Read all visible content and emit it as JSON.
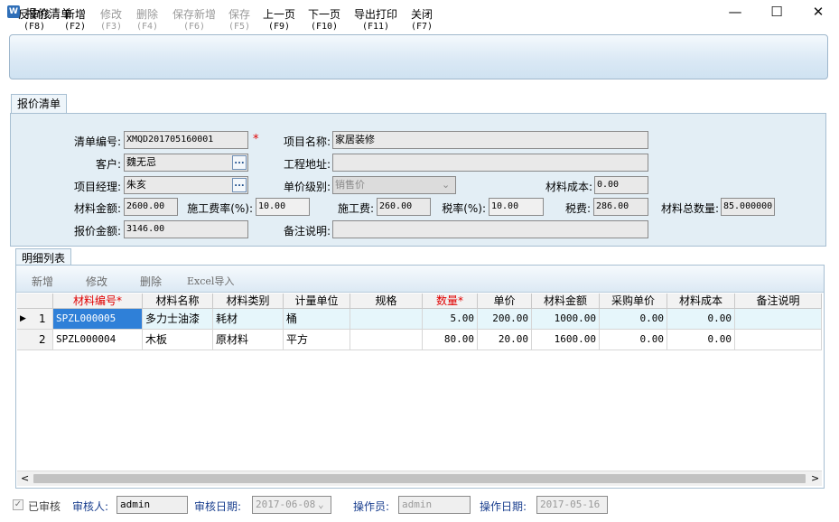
{
  "window": {
    "title": "报价清单",
    "app_icon": "app-logo-icon",
    "minimize_glyph": "—",
    "maximize_glyph": "☐",
    "close_glyph": "✕"
  },
  "toolbar": {
    "buttons": [
      {
        "label": "反审核",
        "key": "(F8)",
        "enabled": true
      },
      {
        "label": "新增",
        "key": "(F2)",
        "enabled": true
      },
      {
        "label": "修改",
        "key": "(F3)",
        "enabled": false
      },
      {
        "label": "删除",
        "key": "(F4)",
        "enabled": false
      },
      {
        "label": "保存新增",
        "key": "(F6)",
        "enabled": false
      },
      {
        "label": "保存",
        "key": "(F5)",
        "enabled": false
      },
      {
        "label": "上一页",
        "key": "(F9)",
        "enabled": true
      },
      {
        "label": "下一页",
        "key": "(F10)",
        "enabled": true
      },
      {
        "label": "导出打印",
        "key": "(F11)",
        "enabled": true
      },
      {
        "label": "关闭",
        "key": "(F7)",
        "enabled": true
      }
    ]
  },
  "main_tab": {
    "label": "报价清单"
  },
  "form": {
    "list_no": {
      "label": "清单编号:",
      "value": "XMQD201705160001",
      "required_mark": "*"
    },
    "project_name": {
      "label": "项目名称:",
      "value": "家居装修"
    },
    "customer": {
      "label": "客户:",
      "value": "魏无忌",
      "picker": "..."
    },
    "project_address": {
      "label": "工程地址:",
      "value": ""
    },
    "project_manager": {
      "label": "项目经理:",
      "value": "朱亥",
      "picker": "..."
    },
    "price_level": {
      "label": "单价级别:",
      "value": "销售价"
    },
    "material_cost": {
      "label": "材料成本:",
      "value": "0.00"
    },
    "material_amount": {
      "label": "材料金额:",
      "value": "2600.00"
    },
    "labor_rate": {
      "label": "施工费率(%):",
      "value": "10.00"
    },
    "labor_fee": {
      "label": "施工费:",
      "value": "260.00"
    },
    "tax_rate": {
      "label": "税率(%):",
      "value": "10.00"
    },
    "tax": {
      "label": "税费:",
      "value": "286.00"
    },
    "material_total_qty": {
      "label": "材料总数量:",
      "value": "85.000000"
    },
    "quote_amount": {
      "label": "报价金额:",
      "value": "3146.00"
    },
    "remarks": {
      "label": "备注说明:",
      "value": ""
    }
  },
  "detail_tab": {
    "label": "明细列表"
  },
  "detail_toolbar": {
    "buttons": [
      {
        "label": "新增"
      },
      {
        "label": "修改"
      },
      {
        "label": "删除"
      },
      {
        "label": "Excel导入"
      }
    ]
  },
  "grid": {
    "columns": [
      {
        "label": "材料编号*",
        "required": true
      },
      {
        "label": "材料名称",
        "required": false
      },
      {
        "label": "材料类别",
        "required": false
      },
      {
        "label": "计量单位",
        "required": false
      },
      {
        "label": "规格",
        "required": false
      },
      {
        "label": "数量*",
        "required": true
      },
      {
        "label": "单价",
        "required": false
      },
      {
        "label": "材料金额",
        "required": false
      },
      {
        "label": "采购单价",
        "required": false
      },
      {
        "label": "材料成本",
        "required": false
      },
      {
        "label": "备注说明",
        "required": false
      }
    ],
    "rows": [
      {
        "index": "1",
        "current_marker": "▶",
        "cells": [
          "SPZL000005",
          "多力士油漆",
          "耗材",
          "桶",
          "",
          "5.00",
          "200.00",
          "1000.00",
          "0.00",
          "0.00",
          ""
        ]
      },
      {
        "index": "2",
        "current_marker": "",
        "cells": [
          "SPZL000004",
          "木板",
          "原材料",
          "平方",
          "",
          "80.00",
          "20.00",
          "1600.00",
          "0.00",
          "0.00",
          ""
        ]
      }
    ],
    "scroll_left": "<",
    "scroll_right": ">"
  },
  "status": {
    "audited": {
      "label": "已审核",
      "checked": true
    },
    "auditor": {
      "label": "审核人:",
      "value": "admin"
    },
    "audit_date": {
      "label": "审核日期:",
      "value": "2017-06-08"
    },
    "operator": {
      "label": "操作员:",
      "value": "admin"
    },
    "operate_date": {
      "label": "操作日期:",
      "value": "2017-05-16"
    }
  }
}
